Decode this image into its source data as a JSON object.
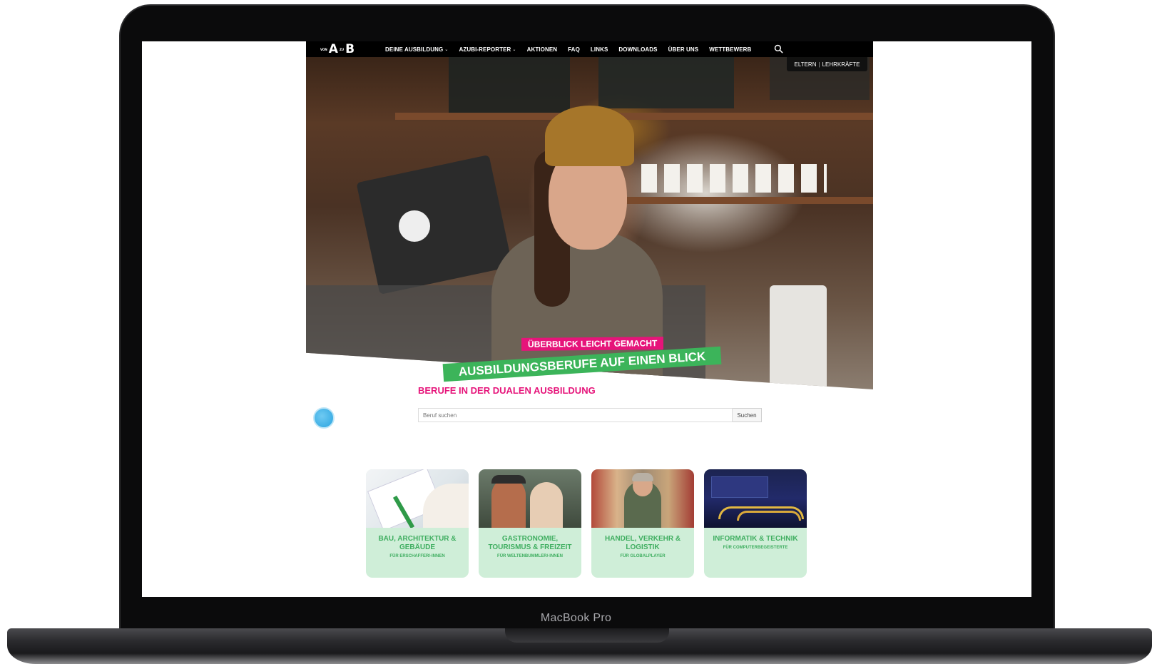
{
  "device": {
    "label": "MacBook Pro"
  },
  "site": {
    "logo": {
      "left": "VON",
      "a": "A",
      "mid": "ZU",
      "b": "B"
    },
    "nav": [
      {
        "label": "DEINE AUSBILDUNG",
        "dropdown": true
      },
      {
        "label": "AZUBI-REPORTER",
        "dropdown": true
      },
      {
        "label": "AKTIONEN",
        "dropdown": false
      },
      {
        "label": "FAQ",
        "dropdown": false
      },
      {
        "label": "LINKS",
        "dropdown": false
      },
      {
        "label": "DOWNLOADS",
        "dropdown": false
      },
      {
        "label": "ÜBER UNS",
        "dropdown": false
      },
      {
        "label": "WETTBEWERB",
        "dropdown": false
      }
    ],
    "audience": {
      "parents": "ELTERN",
      "teachers": "LEHRKRÄFTE"
    },
    "hero": {
      "kicker": "ÜBERBLICK LEICHT GEMACHT",
      "headline": "AUSBILDUNGSBERUFE AUF EINEN BLICK"
    },
    "section": {
      "title": "BERUFE IN DER DUALEN AUSBILDUNG",
      "search_placeholder": "Beruf suchen",
      "search_button": "Suchen"
    },
    "cards": [
      {
        "title": "BAU, ARCHITEKTUR & GEBÄUDE",
        "subtitle": "FÜR ERSCHAFFER/-INNEN"
      },
      {
        "title": "GASTRONOMIE, TOURISMUS & FREIZEIT",
        "subtitle": "FÜR WELTENBUMMLER/-INNEN"
      },
      {
        "title": "HANDEL, VERKEHR & LOGISTIK",
        "subtitle": "FÜR GLOBALPLAYER"
      },
      {
        "title": "INFORMATIK & TECHNIK",
        "subtitle": "FÜR COMPUTERBEGEISTERTE"
      }
    ]
  },
  "colors": {
    "accent_pink": "#e6147a",
    "accent_green": "#3cb45a",
    "card_bg": "#cfeed8",
    "nav_bg": "#000000"
  },
  "icons": [
    "search-icon",
    "chevron-down-icon",
    "chat-icon"
  ]
}
